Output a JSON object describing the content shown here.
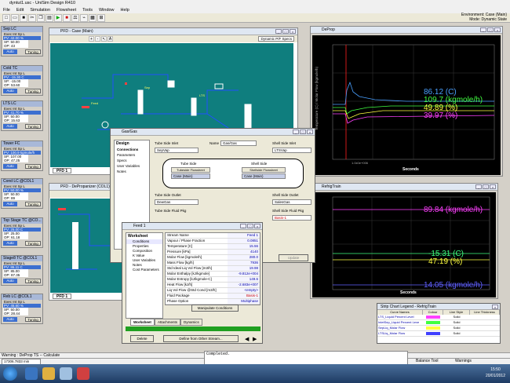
{
  "app": {
    "title": "dyntut1.usc - UniSim Design R410",
    "menu": [
      "File",
      "Edit",
      "Simulation",
      "Flowsheet",
      "Tools",
      "Window",
      "Help"
    ],
    "environment_line1": "Environment: Case (Main)",
    "environment_line2": "Mode: Dynamic State"
  },
  "controllers": [
    {
      "title": "Sep LC",
      "pv": "PV: 42.00 %",
      "sp": "SP: 50.00",
      "op": "OP: 43"
    },
    {
      "title": "Cold TC",
      "pv": "PV: -15.30 C",
      "sp": "SP: -15.00",
      "op": "OP: 53.60"
    },
    {
      "title": "LTS LC",
      "pv": "PV: 41.70 %",
      "sp": "SP: 50.00",
      "op": "OP: 15.63"
    },
    {
      "title": "Tower FC",
      "pv": "PV: 100.9 kgmole/h",
      "sp": "SP: 107.00",
      "op": "OP: 47.25"
    },
    {
      "title": "Cond LC @COL1",
      "pv": "PV: 50.00 %",
      "sp": "SP: 50.00",
      "op": "OP: 89"
    },
    {
      "title": "Top Stage TC @CO...",
      "pv": "PV: 25.00 C",
      "sp": "SP: 25.00",
      "op": "OP: 61.18"
    },
    {
      "title": "Stage8 TC @COL1",
      "pv": "PV: 86.11 C",
      "sp": "SP: 85.00",
      "op": "OP: 87.35"
    },
    {
      "title": "Reb LC @COL1",
      "pv": "PV: 45.60 %",
      "sp": "SP: 50.00",
      "op": "OP: 28.44"
    }
  ],
  "controller_labels": {
    "exec": "Exec Int",
    "sp": "Sp",
    "l": "L",
    "auto": "Auto",
    "tuning": "Tuning"
  },
  "pfd_main": {
    "title": "PFD - Case (Main)",
    "tab": "PFD 1",
    "dynamic_specs": "Dynamic P/F Specs"
  },
  "pfd_depropanizer": {
    "title": "PFD - DePropanizer (COL1)",
    "tab": "PFD 1"
  },
  "deprop_chart": {
    "title": "DeProp",
    "ylabel": "Temperature (C) / Molar Flow (kgmole/h)",
    "xlabel": "Seconds",
    "xtick": "1.0x0e+006",
    "readouts": [
      {
        "text": "86.12 (C)",
        "color": "#4aa0ff"
      },
      {
        "text": "109.7 (kgmole/h)",
        "color": "#40ff40"
      },
      {
        "text": "49.89 (%)",
        "color": "#ffff40"
      },
      {
        "text": "39.97 (%)",
        "color": "#ff40ff"
      }
    ]
  },
  "refrig_chart": {
    "title": "RefrigTrain",
    "xlabel": "Seconds",
    "readouts": [
      {
        "text": "89.84 (kgmole/h)",
        "color": "#ff40ff"
      },
      {
        "text": "-15.31 (C)",
        "color": "#40ff80"
      },
      {
        "text": "47.19 (%)",
        "color": "#ffff40"
      },
      {
        "text": "14.05 (kgmole/h)",
        "color": "#6060ff"
      }
    ]
  },
  "gas_gas": {
    "title": "Gas/Gas",
    "name_label": "Name",
    "name_value": "Gas/Gas",
    "design_tab": "Design",
    "nav": [
      "Connections",
      "Parameters",
      "Specs",
      "User Variables",
      "Notes"
    ],
    "tube_inlet_label": "Tube Side Inlet",
    "tube_inlet_value": "SepVap",
    "shell_inlet_label": "Shell Side Inlet",
    "shell_inlet_value": "LTSVap",
    "tube_side": "Tube Side",
    "tube_flowsheet": "Tubeside Flowsheet",
    "tube_case": "Case (Main)",
    "shell_side": "Shell Side",
    "shell_flowsheet": "Shellside Flowsheet",
    "shell_case": "Case (Main)",
    "tube_outlet_label": "Tube Side Outlet",
    "tube_outlet_value": "DewGas",
    "shell_outlet_label": "Shell Side Outlet",
    "shell_outlet_value": "SalesGas",
    "tube_plug_label": "Tube Side Fluid Pkg",
    "shell_plug_label": "Shell Side Fluid Pkg",
    "shell_plug_value": "Basis-1",
    "update_btn": "Update"
  },
  "feed": {
    "title": "Feed 1",
    "worksheet_heading": "Worksheet",
    "nav": [
      "Conditions",
      "Properties",
      "Composition",
      "K Value",
      "User Variables",
      "Notes",
      "Cost Parameters"
    ],
    "column_header": "Feed 1",
    "rows": [
      [
        "Stream Name",
        "Feed 1"
      ],
      [
        "Vapour / Phase Fraction",
        "0.0851"
      ],
      [
        "Temperature [C]",
        "15.56"
      ],
      [
        "Pressure [kPa]",
        "4140"
      ],
      [
        "Molar Flow [kgmole/h]",
        "280.0"
      ],
      [
        "Mass Flow [kg/h]",
        "7936"
      ],
      [
        "Std Ideal Liq Vol Flow [m3/h]",
        "19.98"
      ],
      [
        "Molar Enthalpy [kJ/kgmole]",
        "-9.812e+004"
      ],
      [
        "Molar Entropy [kJ/kgmole-C]",
        "149.6"
      ],
      [
        "Heat Flow [kJ/h]",
        "-2.683e+007"
      ],
      [
        "Liq Vol Flow @Std Cond [m3/h]",
        "<empty>"
      ],
      [
        "Fluid Package",
        "Basis-1"
      ],
      [
        "Phase Option",
        "Multiphase"
      ]
    ],
    "manipulate_btn": "Manipulate Conditions",
    "tabs": [
      "Worksheet",
      "Attachments",
      "Dynamics"
    ],
    "delete_btn": "Delete",
    "define_btn": "Define from Other Stream..."
  },
  "legend": {
    "title": "Strip Chart Legend - RefrigTrain",
    "headers": [
      "Curve Names",
      "Colour",
      "Line Style",
      "Line Thickness"
    ],
    "rows": [
      {
        "name": "LTS_Liquid Percent Level",
        "color": "#ff40ff",
        "style": "Solid"
      },
      {
        "name": "InletSep_Liquid Percent Leve",
        "color": "#40ff40",
        "style": "Solid"
      },
      {
        "name": "SepLiq_Molar Flow",
        "color": "#ffff40",
        "style": "Solid"
      },
      {
        "name": "LTSLiq_Molar Flow",
        "color": "#4040ff",
        "style": "Solid"
      }
    ]
  },
  "status": {
    "warning": "Warning : DeProp TS -- Calculate",
    "counter": "17306.7833 min",
    "completed": "Completed.",
    "balance": "Balance Tool",
    "warnings": "Warnings"
  },
  "taskbar": {
    "time": "15:50",
    "date": "20/01/2012"
  }
}
